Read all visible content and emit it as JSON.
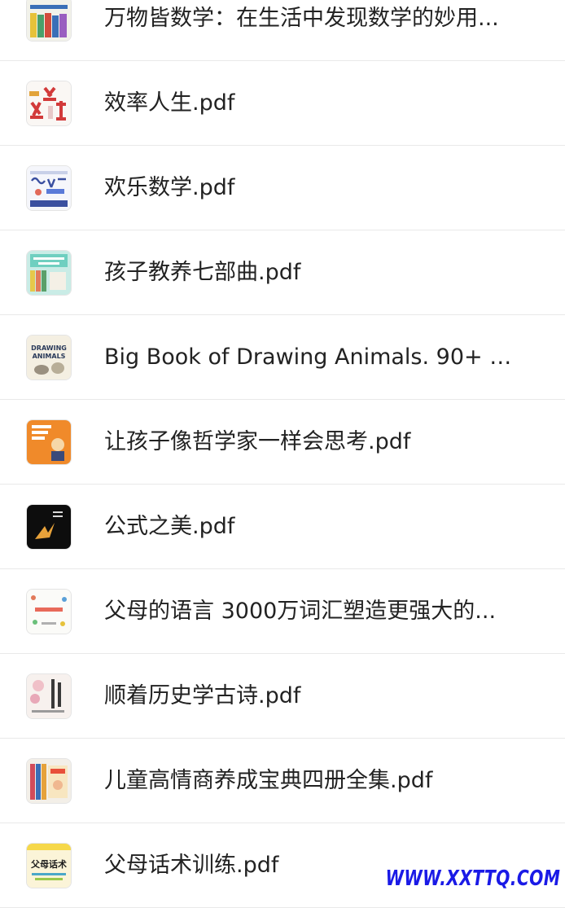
{
  "files": [
    {
      "title": "万物皆数学：在生活中发现数学的妙用...",
      "icon": "book-cover-math-everywhere-icon"
    },
    {
      "title": "效率人生.pdf",
      "icon": "book-cover-efficient-life-icon"
    },
    {
      "title": "欢乐数学.pdf",
      "icon": "book-cover-happy-math-icon"
    },
    {
      "title": "孩子教养七部曲.pdf",
      "icon": "book-cover-parenting-seven-icon"
    },
    {
      "title": "Big Book of Drawing Animals. 90+ Do...",
      "icon": "book-cover-drawing-animals-icon",
      "cover_text": "DRAWING ANIMALS"
    },
    {
      "title": "让孩子像哲学家一样会思考.pdf",
      "icon": "book-cover-philosopher-icon"
    },
    {
      "title": "公式之美.pdf",
      "icon": "book-cover-formula-beauty-icon"
    },
    {
      "title": "父母的语言 3000万词汇塑造更强大的...",
      "icon": "book-cover-parents-language-icon"
    },
    {
      "title": "顺着历史学古诗.pdf",
      "icon": "book-cover-history-poems-icon"
    },
    {
      "title": "儿童高情商养成宝典四册全集.pdf",
      "icon": "book-cover-eq-handbook-icon"
    },
    {
      "title": "父母话术训练.pdf",
      "icon": "book-cover-parent-talk-icon",
      "cover_text": "父母话术"
    }
  ],
  "watermark": "WWW.XXTTQ.COM"
}
